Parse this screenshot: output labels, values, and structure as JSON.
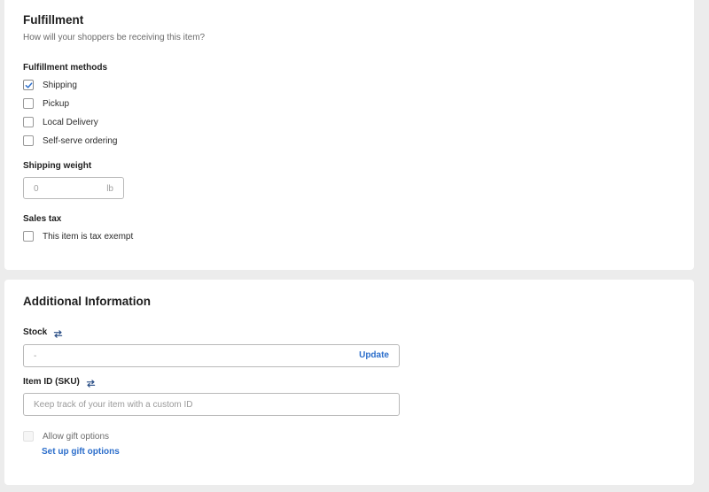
{
  "fulfillment": {
    "title": "Fulfillment",
    "subtitle": "How will your shoppers be receiving this item?",
    "methods_label": "Fulfillment methods",
    "methods": [
      {
        "label": "Shipping",
        "checked": true
      },
      {
        "label": "Pickup",
        "checked": false
      },
      {
        "label": "Local Delivery",
        "checked": false
      },
      {
        "label": "Self-serve ordering",
        "checked": false
      }
    ],
    "shipping_weight_label": "Shipping weight",
    "shipping_weight_value": "0",
    "shipping_weight_unit": "lb",
    "sales_tax_label": "Sales tax",
    "tax_exempt_label": "This item is tax exempt",
    "tax_exempt_checked": false
  },
  "additional": {
    "title": "Additional Information",
    "stock_label": "Stock",
    "stock_value": "-",
    "stock_action": "Update",
    "sku_label": "Item ID (SKU)",
    "sku_placeholder": "Keep track of your item with a custom ID",
    "gift_label": "Allow gift options",
    "gift_checked": false,
    "gift_disabled": true,
    "gift_link": "Set up gift options"
  },
  "icons": {
    "checkmark": "checkmark-icon",
    "sync": "sync-arrows-icon"
  },
  "colors": {
    "link": "#2c6ecb",
    "check": "#2c6ecb",
    "background": "#ececec",
    "card": "#ffffff"
  }
}
